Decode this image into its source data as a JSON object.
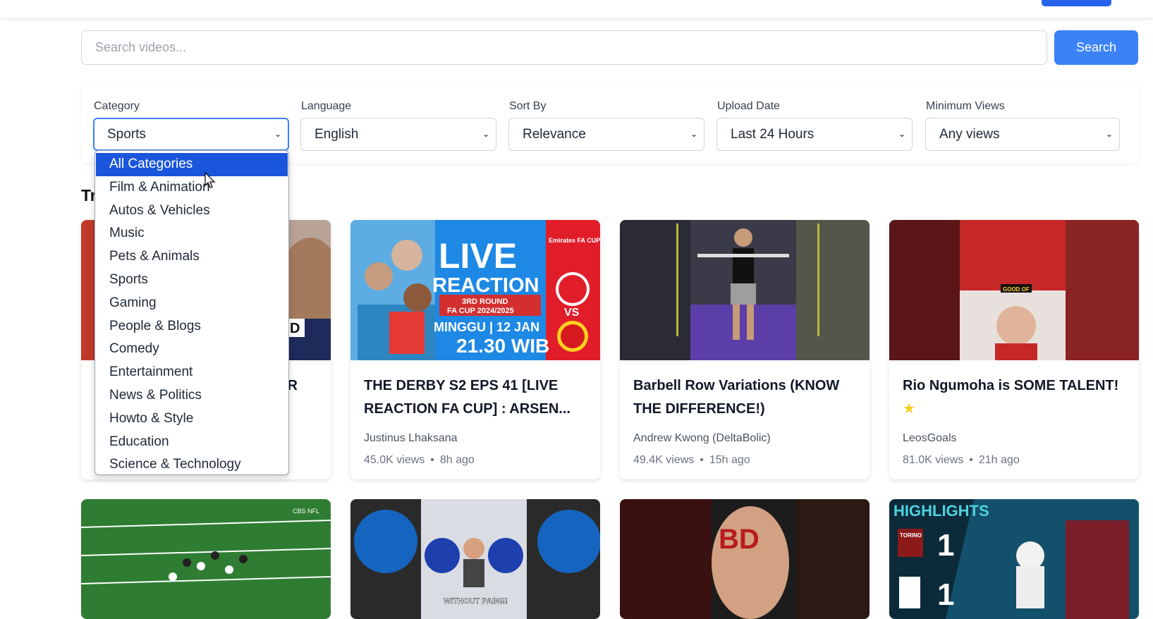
{
  "search": {
    "placeholder": "Search videos...",
    "button": "Search"
  },
  "filters": [
    {
      "label": "Category",
      "value": "Sports"
    },
    {
      "label": "Language",
      "value": "English"
    },
    {
      "label": "Sort By",
      "value": "Relevance"
    },
    {
      "label": "Upload Date",
      "value": "Last 24 Hours"
    },
    {
      "label": "Minimum Views",
      "value": "Any views"
    }
  ],
  "category_options": [
    "All Categories",
    "Film & Animation",
    "Autos & Vehicles",
    "Music",
    "Pets & Animals",
    "Sports",
    "Gaming",
    "People & Blogs",
    "Comedy",
    "Entertainment",
    "News & Politics",
    "Howto & Style",
    "Education",
    "Science & Technology"
  ],
  "section": {
    "title_visible": "Tr"
  },
  "videos": [
    {
      "title_partial": "R",
      "thumb_text": "D"
    },
    {
      "title": "THE DERBY S2 EPS 41 [LIVE REACTION FA CUP] : ARSEN...",
      "channel": "Justinus Lhaksana",
      "views": "45.0K views",
      "age": "8h ago",
      "thumb_text": {
        "live": "LIVE",
        "reaction": "REACTION",
        "round": "3RD ROUND",
        "cup": "FA CUP 2024/2025",
        "date": "MINGGU | 12 JAN",
        "time": "21.30 WIB",
        "vs": "VS",
        "fa": "Emirates FA CUP"
      }
    },
    {
      "title": "Barbell Row Variations (KNOW THE DIFFERENCE!)",
      "channel": "Andrew Kwong (DeltaBolic)",
      "views": "49.4K views",
      "age": "15h ago"
    },
    {
      "title": "Rio Ngumoha is SOME TALENT!",
      "channel": "LeosGoals",
      "views": "81.0K views",
      "age": "21h ago",
      "thumb_text": "GOOD OF"
    }
  ],
  "row2": [
    {
      "thumb_text": "CBS NFL"
    },
    {
      "thumb_text": "WITHOUT PAIN!!!"
    },
    {
      "thumb_text": "BD"
    },
    {
      "thumb_text": {
        "highlights": "HIGHLIGHTS",
        "team1": "TORINO",
        "score1": "1",
        "score2": "1"
      }
    }
  ],
  "colors": {
    "accent": "#3b82f6",
    "selected": "#1a56db",
    "red": "#e11d2a",
    "blue_thumb": "#1e88e5"
  }
}
